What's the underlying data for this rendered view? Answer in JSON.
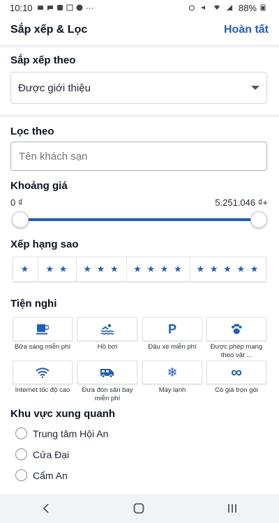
{
  "status_bar": {
    "time": "10:10",
    "battery": "88%"
  },
  "header": {
    "title": "Sắp xếp & Lọc",
    "done_label": "Hoàn tất"
  },
  "sort": {
    "title": "Sắp xếp theo",
    "selected": "Được giới thiệu"
  },
  "filter": {
    "title": "Lọc theo",
    "hotel_name_placeholder": "Tên khách sạn"
  },
  "price": {
    "title": "Khoảng giá",
    "min_label": "0 ₫",
    "max_label": "5.251.046 ₫+",
    "range_fraction": [
      0,
      1
    ]
  },
  "stars": {
    "title": "Xếp hạng sao",
    "options": [
      "★",
      "★ ★",
      "★ ★ ★",
      "★ ★ ★ ★",
      "★ ★ ★ ★ ★"
    ]
  },
  "amenities": {
    "title": "Tiện nghi",
    "items": [
      {
        "label": "Bữa sáng miễn phí",
        "icon": "coffee-icon"
      },
      {
        "label": "Hồ bơi",
        "icon": "pool-icon"
      },
      {
        "label": "Đậu xe miễn phí",
        "icon": "parking-icon"
      },
      {
        "label": "Được phép mang theo vật ...",
        "icon": "paw-icon"
      },
      {
        "label": "Internet tốc độ cao",
        "icon": "wifi-icon"
      },
      {
        "label": "Đưa đón sân bay miễn phí",
        "icon": "shuttle-icon"
      },
      {
        "label": "Máy lạnh",
        "icon": "snowflake-icon"
      },
      {
        "label": "Có giá trọn gói",
        "icon": "infinity-icon"
      }
    ]
  },
  "area": {
    "title": "Khu vực xung quanh",
    "options": [
      "Trung tâm Hội An",
      "Cửa Đại",
      "Cẩm An"
    ]
  },
  "colors": {
    "accent": "#1f5fb8",
    "background": "#eff1f5"
  }
}
